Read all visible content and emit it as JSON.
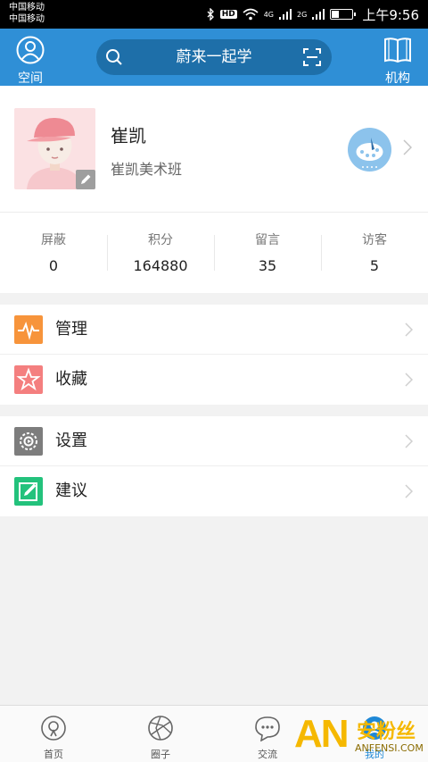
{
  "status_bar": {
    "carrier_1": "中国移动",
    "carrier_2": "中国移动",
    "network_1": "4G",
    "network_2": "2G",
    "hd": "HD",
    "battery_level": 0.35,
    "time": "上午9:56"
  },
  "header": {
    "left_label": "空间",
    "search_text": "蔚来一起学",
    "right_label": "机构",
    "background_color": "#2f8fd6"
  },
  "profile": {
    "name": "崔凯",
    "class_name": "崔凯美术班"
  },
  "stats": [
    {
      "label": "屏蔽",
      "value": "0"
    },
    {
      "label": "积分",
      "value": "164880"
    },
    {
      "label": "留言",
      "value": "35"
    },
    {
      "label": "访客",
      "value": "5"
    }
  ],
  "menu": {
    "group1": [
      {
        "label": "管理",
        "icon": "pulse-icon",
        "color": "#f7943b"
      },
      {
        "label": "收藏",
        "icon": "star-icon",
        "color": "#f47f7f"
      }
    ],
    "group2": [
      {
        "label": "设置",
        "icon": "gear-icon",
        "color": "#7d7d7d"
      },
      {
        "label": "建议",
        "icon": "pencil-icon",
        "color": "#23c27c"
      }
    ]
  },
  "tabbar": {
    "tabs": [
      {
        "label": "首页",
        "icon": "home-icon"
      },
      {
        "label": "圈子",
        "icon": "circle-icon"
      },
      {
        "label": "交流",
        "icon": "chat-icon"
      },
      {
        "label": "我的",
        "icon": "user-icon",
        "active": true
      }
    ]
  },
  "watermark": {
    "brand": "AN",
    "chinese": "安粉丝",
    "site": "ANFENSI.COM"
  }
}
